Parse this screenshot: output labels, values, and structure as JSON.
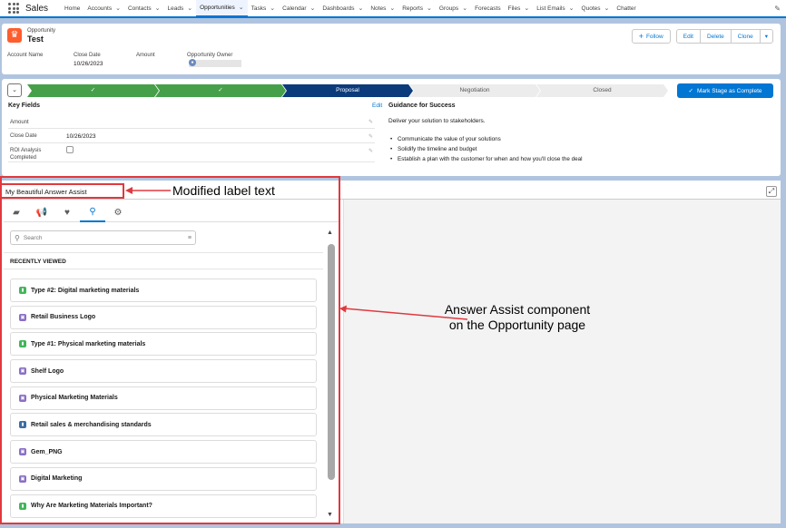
{
  "nav": {
    "app_name": "Sales",
    "items": [
      {
        "label": "Home",
        "has_menu": false
      },
      {
        "label": "Accounts",
        "has_menu": true
      },
      {
        "label": "Contacts",
        "has_menu": true
      },
      {
        "label": "Leads",
        "has_menu": true
      },
      {
        "label": "Opportunities",
        "has_menu": true,
        "active": true
      },
      {
        "label": "Tasks",
        "has_menu": true
      },
      {
        "label": "Calendar",
        "has_menu": true
      },
      {
        "label": "Dashboards",
        "has_menu": true
      },
      {
        "label": "Notes",
        "has_menu": true
      },
      {
        "label": "Reports",
        "has_menu": true
      },
      {
        "label": "Groups",
        "has_menu": true
      },
      {
        "label": "Forecasts",
        "has_menu": false
      },
      {
        "label": "Files",
        "has_menu": true
      },
      {
        "label": "List Emails",
        "has_menu": true
      },
      {
        "label": "Quotes",
        "has_menu": true
      },
      {
        "label": "Chatter",
        "has_menu": false
      }
    ]
  },
  "record": {
    "object_label": "Opportunity",
    "name": "Test",
    "buttons": {
      "follow": "Follow",
      "edit": "Edit",
      "delete": "Delete",
      "clone": "Clone"
    },
    "fields": {
      "account_name_label": "Account Name",
      "close_date_label": "Close Date",
      "close_date_value": "10/26/2023",
      "amount_label": "Amount",
      "owner_label": "Opportunity Owner"
    }
  },
  "path": {
    "stages": [
      {
        "label": "✓",
        "state": "done"
      },
      {
        "label": "✓",
        "state": "done"
      },
      {
        "label": "Proposal",
        "state": "current"
      },
      {
        "label": "Negotiation",
        "state": "todo"
      },
      {
        "label": "Closed",
        "state": "todo"
      }
    ],
    "mark_button": "Mark Stage as Complete",
    "key_fields_title": "Key Fields",
    "edit_link": "Edit",
    "key_fields": [
      {
        "label": "Amount",
        "value": ""
      },
      {
        "label": "Close Date",
        "value": "10/26/2023"
      },
      {
        "label": "ROI Analysis Completed",
        "value": ""
      }
    ],
    "guidance_title": "Guidance for Success",
    "guidance_desc": "Deliver your solution to stakeholders.",
    "guidance_items": [
      "Communicate the value of your solutions",
      "Solidify the timeline and budget",
      "Establish a plan with the customer for when and how you'll close the deal"
    ]
  },
  "answer_assist": {
    "title": "My Beautiful Answer Assist",
    "search_placeholder": "Search",
    "recently_viewed": "RECENTLY VIEWED",
    "items": [
      {
        "label": "Type #2: Digital marketing materials",
        "icon": "green"
      },
      {
        "label": "Retail Business Logo",
        "icon": "purple"
      },
      {
        "label": "Type #1: Physical marketing materials",
        "icon": "green"
      },
      {
        "label": "Shelf Logo",
        "icon": "purple"
      },
      {
        "label": "Physical Marketing Materials",
        "icon": "purple"
      },
      {
        "label": "Retail sales & merchandising standards",
        "icon": "blue"
      },
      {
        "label": "Gem_PNG",
        "icon": "purple"
      },
      {
        "label": "Digital Marketing",
        "icon": "purple"
      },
      {
        "label": "Why Are Marketing Materials Important?",
        "icon": "green"
      }
    ]
  },
  "annotations": {
    "label_note": "Modified label text",
    "component_note": "Answer Assist component on the Opportunity page"
  },
  "colors": {
    "brand": "#0176d3",
    "done": "#45a049",
    "current": "#0b3b7a",
    "annotation": "#e0393e"
  }
}
